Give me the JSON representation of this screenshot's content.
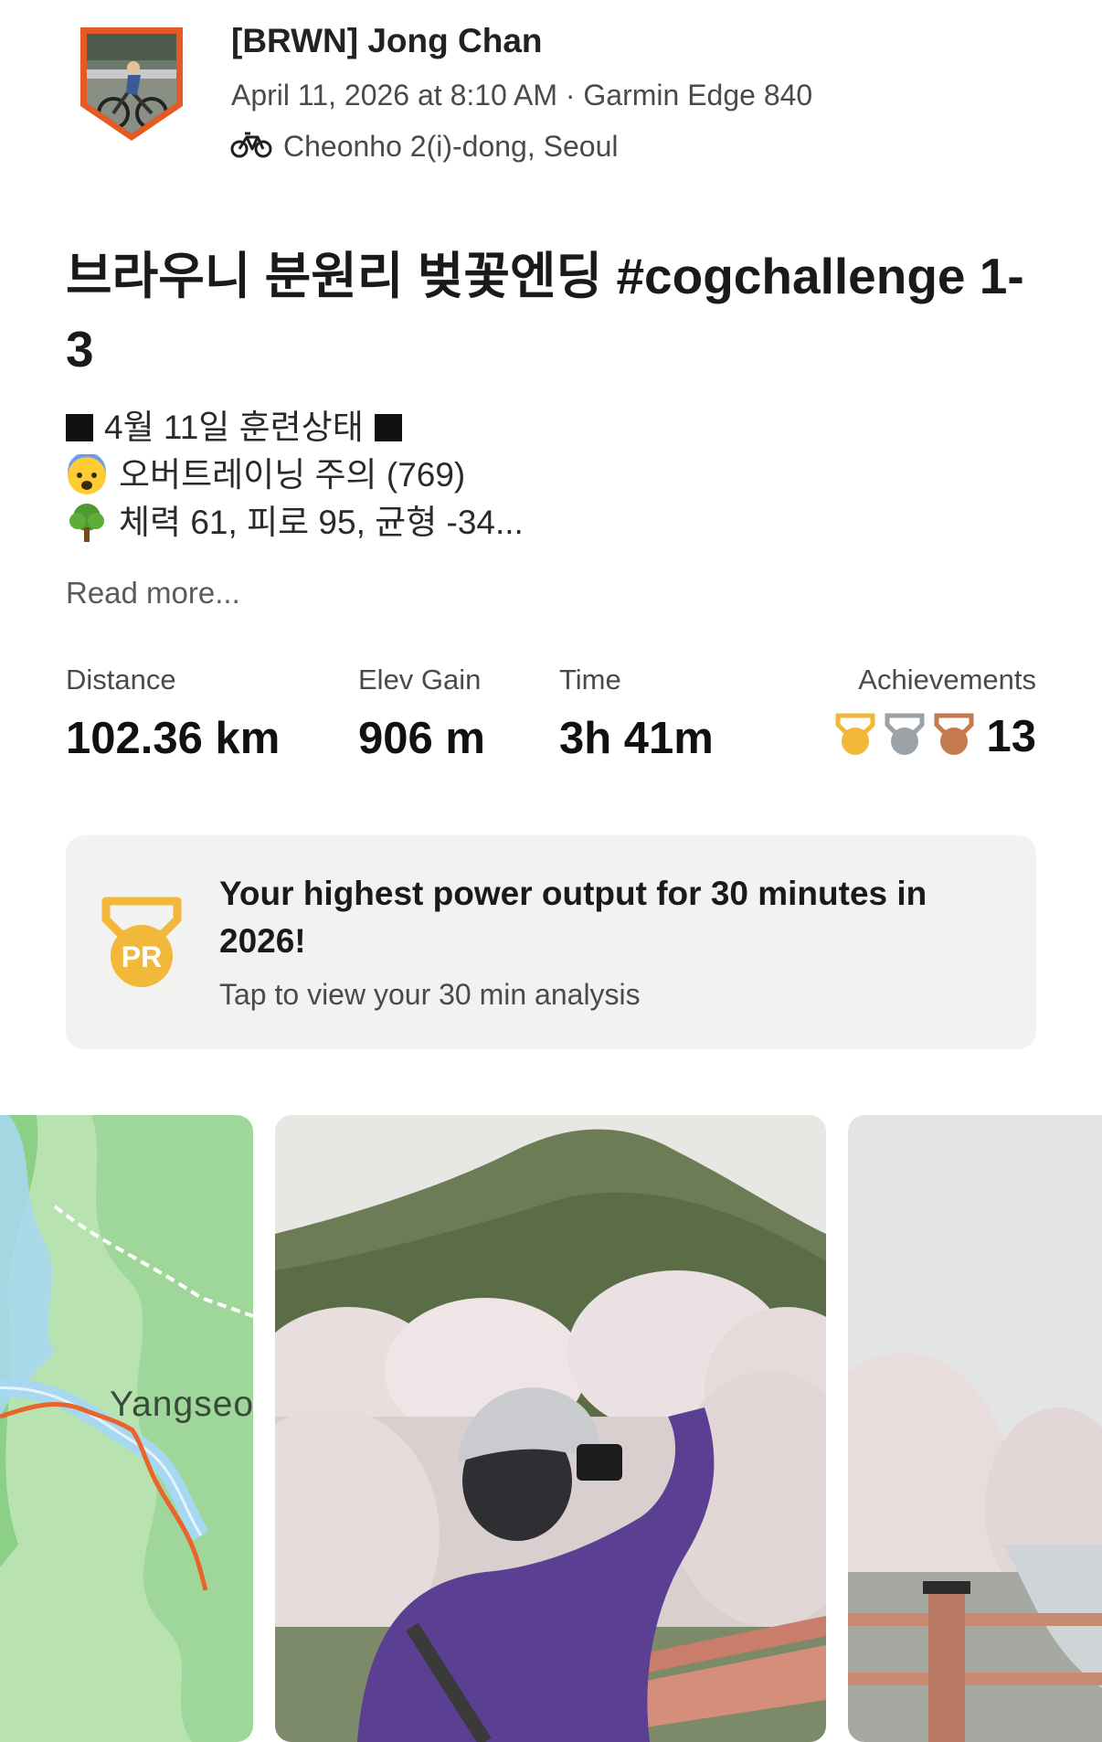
{
  "header": {
    "athlete_name": "[BRWN] Jong Chan",
    "meta": "April 11, 2026 at 8:10 AM · Garmin Edge 840",
    "location": "Cheonho 2(i)-dong, Seoul",
    "activity_icon": "bike-icon"
  },
  "activity": {
    "title": "브라우니 분원리 벚꽃엔딩 #cogchallenge 1-3",
    "description": {
      "line1": "4월 11일 훈련상태",
      "line2": "오버트레이닝 주의 (769)",
      "line3": "체력 61, 피로 95, 균형 -34..."
    },
    "read_more": "Read more..."
  },
  "stats": {
    "distance": {
      "label": "Distance",
      "value": "102.36 km"
    },
    "elev_gain": {
      "label": "Elev Gain",
      "value": "906 m"
    },
    "time": {
      "label": "Time",
      "value": "3h 41m"
    },
    "achievements": {
      "label": "Achievements",
      "value": "13",
      "icons": [
        "gold-medal-icon",
        "silver-medal-icon",
        "bronze-medal-icon"
      ]
    }
  },
  "pr_card": {
    "title": "Your highest power output for 30 minutes in 2026!",
    "subtitle": "Tap to view your 30 min analysis",
    "badge": "PR"
  },
  "media": {
    "map_label": "Yangseo"
  },
  "colors": {
    "gold": "#F2B83A",
    "silver": "#9BA3A8",
    "bronze": "#C47A4C",
    "pr_badge": "#F2B83A",
    "route": "#E8642C",
    "avatar_border": "#E35A22"
  }
}
